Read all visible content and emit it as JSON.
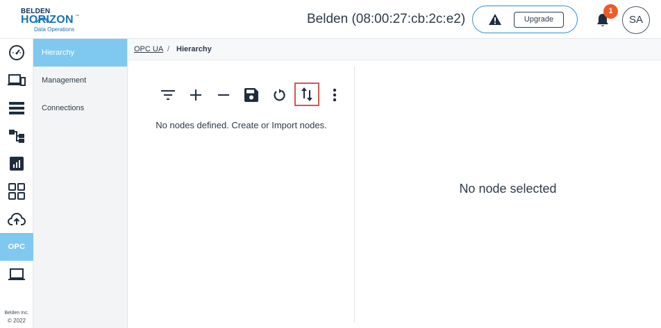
{
  "header": {
    "logo": {
      "top": "BELDEN",
      "main": "HORIZON",
      "tm": "™",
      "sub": "Data Operations"
    },
    "device_title": "Belden (08:00:27:cb:2c:e2)",
    "upgrade_label": "Upgrade",
    "notification_count": "1",
    "avatar_initials": "SA"
  },
  "rail": {
    "items": [
      {
        "icon": "dashboard-icon"
      },
      {
        "icon": "devices-icon"
      },
      {
        "icon": "server-list-icon"
      },
      {
        "icon": "hierarchy-icon"
      },
      {
        "icon": "bar-chart-icon"
      },
      {
        "icon": "apps-grid-icon"
      },
      {
        "icon": "cloud-upload-icon"
      },
      {
        "label": "OPC",
        "active": true
      },
      {
        "icon": "laptop-icon"
      }
    ],
    "footer_company": "Belden Inc.",
    "footer_year": "© 2022"
  },
  "submenu": {
    "items": [
      {
        "label": "Hierarchy",
        "active": true
      },
      {
        "label": "Management",
        "active": false
      },
      {
        "label": "Connections",
        "active": false
      }
    ]
  },
  "breadcrumb": {
    "link": "OPC UA",
    "separator": "/",
    "current": "Hierarchy"
  },
  "toolbar": {
    "tools": [
      "filter-icon",
      "add-icon",
      "remove-icon",
      "save-icon",
      "refresh-icon",
      "import-export-icon",
      "more-vert-icon"
    ],
    "highlighted_tool": "import-export-icon",
    "highlight_color": "#d9534f"
  },
  "tree": {
    "empty_message": "No nodes defined. Create or Import nodes."
  },
  "details": {
    "empty_message": "No node selected"
  },
  "colors": {
    "accent": "#7fc8ef",
    "brand_blue": "#1673b8",
    "pill_border": "#2e8fd8",
    "badge": "#f05a28",
    "text": "#2d3a48"
  }
}
